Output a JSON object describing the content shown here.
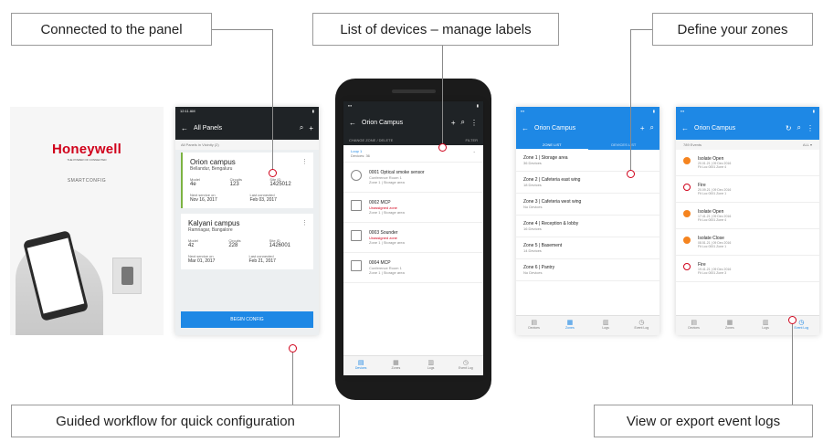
{
  "callouts": {
    "connected": "Connected to the panel",
    "devices": "List of devices – manage labels",
    "zones": "Define your zones",
    "workflow": "Guided workflow for quick configuration",
    "logs": "View or export event logs"
  },
  "colors": {
    "brand_red": "#d0021b",
    "accent_blue": "#1e88e5",
    "active_green": "#7cb342",
    "dark_bar": "#1f2326"
  },
  "splash": {
    "logo": "Honeywell",
    "tagline": "THE POWER OF CONNECTED",
    "app_name": "SMARTCONFIG"
  },
  "panels_screen": {
    "status_time": "12:11 AM",
    "title": "All Panels",
    "subtitle": "All Panels in Vicinity (2)",
    "cards": [
      {
        "name": "Orion campus",
        "location": "Bellandur, Bengaluru",
        "f1_label": "Model",
        "f1_value": "4e",
        "f2_label": "Circuits",
        "f2_value": "123",
        "f3_label": "Site ID",
        "f3_value": "1425012",
        "f4_label": "Next service on",
        "f4_value": "Nov 16, 2017",
        "f5_label": "Last connected",
        "f5_value": "Feb 03, 2017"
      },
      {
        "name": "Kalyani campus",
        "location": "Ramnagar, Bangalore",
        "f1_label": "Model",
        "f1_value": "4z",
        "f2_label": "Circuits",
        "f2_value": "228",
        "f3_label": "Site ID",
        "f3_value": "1426001",
        "f4_label": "Next service on",
        "f4_value": "Mar 01, 2017",
        "f5_label": "Last connected",
        "f5_value": "Feb 21, 2017"
      }
    ],
    "cta": "BEGIN CONFIG"
  },
  "devices_screen": {
    "title": "Orion Campus",
    "bar_left": "CHANGE ZONE / DELETE",
    "bar_right": "FILTER",
    "zone_label": "Loop 1",
    "zone_sub": "Devices: 36",
    "devices": [
      {
        "title": "0001  Optical smoke sensor",
        "alert": "",
        "detail": "Conference Room 1",
        "detail2": "Zone 1 | Storage area"
      },
      {
        "title": "0002  MCP",
        "alert": "Unassigned zone",
        "detail": "Zone 1 | Storage area",
        "detail2": ""
      },
      {
        "title": "0003  Sounder",
        "alert": "Unassigned zone",
        "detail": "Zone 1 | Storage area",
        "detail2": ""
      },
      {
        "title": "0004  MCP",
        "alert": "",
        "detail": "Conference Room 1",
        "detail2": "Zone 1 | Storage area"
      }
    ],
    "nav": [
      "Devices",
      "Zones",
      "Logs",
      "Event Log"
    ]
  },
  "zones_screen": {
    "title": "Orion Campus",
    "tab1": "ZONE LIST",
    "tab2": "DEVICES LIST",
    "zones": [
      {
        "name": "Zone 1  |  Storage area",
        "count": "36 Devices"
      },
      {
        "name": "Zone 2  |  Cafeteria east wing",
        "count": "18 Devices"
      },
      {
        "name": "Zone 3  |  Cafeteria west wing",
        "count": "No Devices"
      },
      {
        "name": "Zone 4  |  Reception & lobby",
        "count": "16 Devices"
      },
      {
        "name": "Zone 5  |  Basement",
        "count": "14 Devices"
      },
      {
        "name": "Zone 6  |  Pantry",
        "count": "No Devices"
      }
    ],
    "nav": [
      "Devices",
      "Zones",
      "Logs",
      "Event Log"
    ]
  },
  "events_screen": {
    "title": "Orion Campus",
    "sub_left": "789 Events",
    "sub_right": "ALL ▾",
    "events": [
      {
        "title": "Isolate Open",
        "line1": "20.01.21 | 09 Dec 2016",
        "line2": "Fit Loc 0001 Zone 4",
        "color": "#f5841f"
      },
      {
        "title": "Fire",
        "line1": "20.09.21 | 09 Dec 2016",
        "line2": "Fit Loc 0001 Zone 1",
        "color": "#d0021b"
      },
      {
        "title": "Isolate Open",
        "line1": "17.41.21 | 09 Dec 2016",
        "line2": "Fit Loc 0001 Zone 4",
        "color": "#f5841f"
      },
      {
        "title": "Isolate Close",
        "line1": "08.51.21 | 09 Dec 2016",
        "line2": "Fit Loc 0001 Zone 1",
        "color": "#f5841f"
      },
      {
        "title": "Fire",
        "line1": "19.41.21 | 09 Dec 2016",
        "line2": "Fit Loc 0001 Zone 3",
        "color": "#d0021b"
      }
    ],
    "nav": [
      "Devices",
      "Zones",
      "Logs",
      "Event Log"
    ]
  }
}
